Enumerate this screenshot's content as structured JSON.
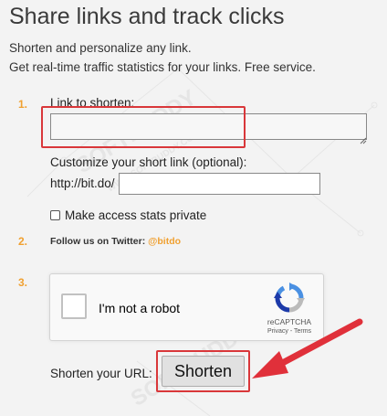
{
  "header": {
    "title": "Share links and track clicks",
    "subtitle_line1": "Shorten and personalize any link.",
    "subtitle_line2": "Get real-time traffic statistics for your links. Free service."
  },
  "step1": {
    "number": "1.",
    "link_label": "Link to shorten:",
    "link_value": "",
    "customize_label": "Customize your short link (optional):",
    "prefix": "http://bit.do/",
    "custom_value": "",
    "private_label": "Make access stats private",
    "private_checked": false
  },
  "step2": {
    "number": "2.",
    "follow_text": "Follow us on Twitter: ",
    "handle": "@bitdo"
  },
  "step3": {
    "number": "3.",
    "captcha_label": "I'm not a robot",
    "captcha_brand": "reCAPTCHA",
    "captcha_links": "Privacy - Terms",
    "shorten_label": "Shorten your URL:",
    "shorten_button": "Shorten"
  },
  "watermark": {
    "text1": "SOFTBUDDY",
    "text2": "WWW.SOFTBUDDY.COM"
  },
  "colors": {
    "accent": "#f0a030",
    "highlight": "#d9373a"
  }
}
